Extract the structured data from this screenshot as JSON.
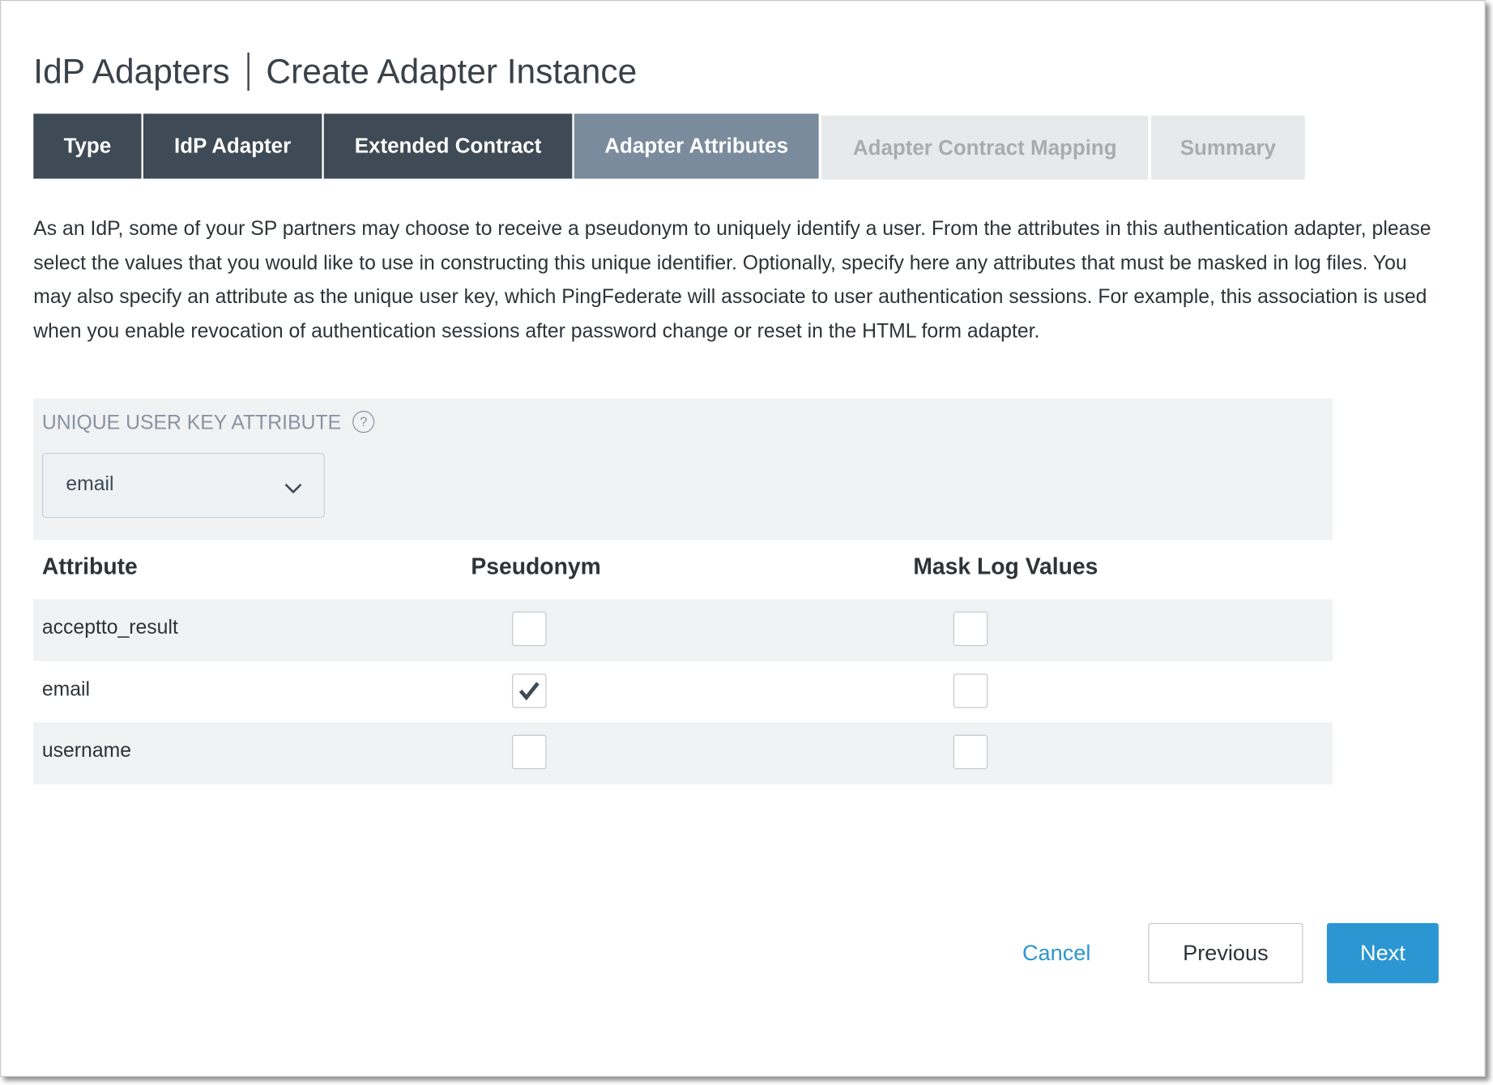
{
  "title": {
    "section": "IdP Adapters",
    "page": "Create Adapter Instance"
  },
  "tabs": [
    {
      "label": "Type",
      "state": "completed"
    },
    {
      "label": "IdP Adapter",
      "state": "completed"
    },
    {
      "label": "Extended Contract",
      "state": "completed"
    },
    {
      "label": "Adapter Attributes",
      "state": "active"
    },
    {
      "label": "Adapter Contract Mapping",
      "state": "upcoming"
    },
    {
      "label": "Summary",
      "state": "upcoming"
    }
  ],
  "description": "As an IdP, some of your SP partners may choose to receive a pseudonym to uniquely identify a user. From the attributes in this authentication adapter, please select the values that you would like to use in constructing this unique identifier. Optionally, specify here any attributes that must be masked in log files. You may also specify an attribute as the unique user key, which PingFederate will associate to user authentication sessions. For example, this association is used when you enable revocation of authentication sessions after password change or reset in the HTML form adapter.",
  "unique_user_key": {
    "label": "UNIQUE USER KEY ATTRIBUTE",
    "help_icon": "question-circle",
    "value": "email"
  },
  "table": {
    "headers": {
      "attribute": "Attribute",
      "pseudonym": "Pseudonym",
      "mask": "Mask Log Values"
    },
    "rows": [
      {
        "attribute": "acceptto_result",
        "pseudonym": false,
        "mask": false
      },
      {
        "attribute": "email",
        "pseudonym": true,
        "mask": false
      },
      {
        "attribute": "username",
        "pseudonym": false,
        "mask": false
      }
    ]
  },
  "buttons": {
    "cancel": "Cancel",
    "previous": "Previous",
    "next": "Next"
  },
  "colors": {
    "accent": "#2b96d1",
    "tab_done": "#3e4a55",
    "tab_active": "#7a8b9d"
  }
}
